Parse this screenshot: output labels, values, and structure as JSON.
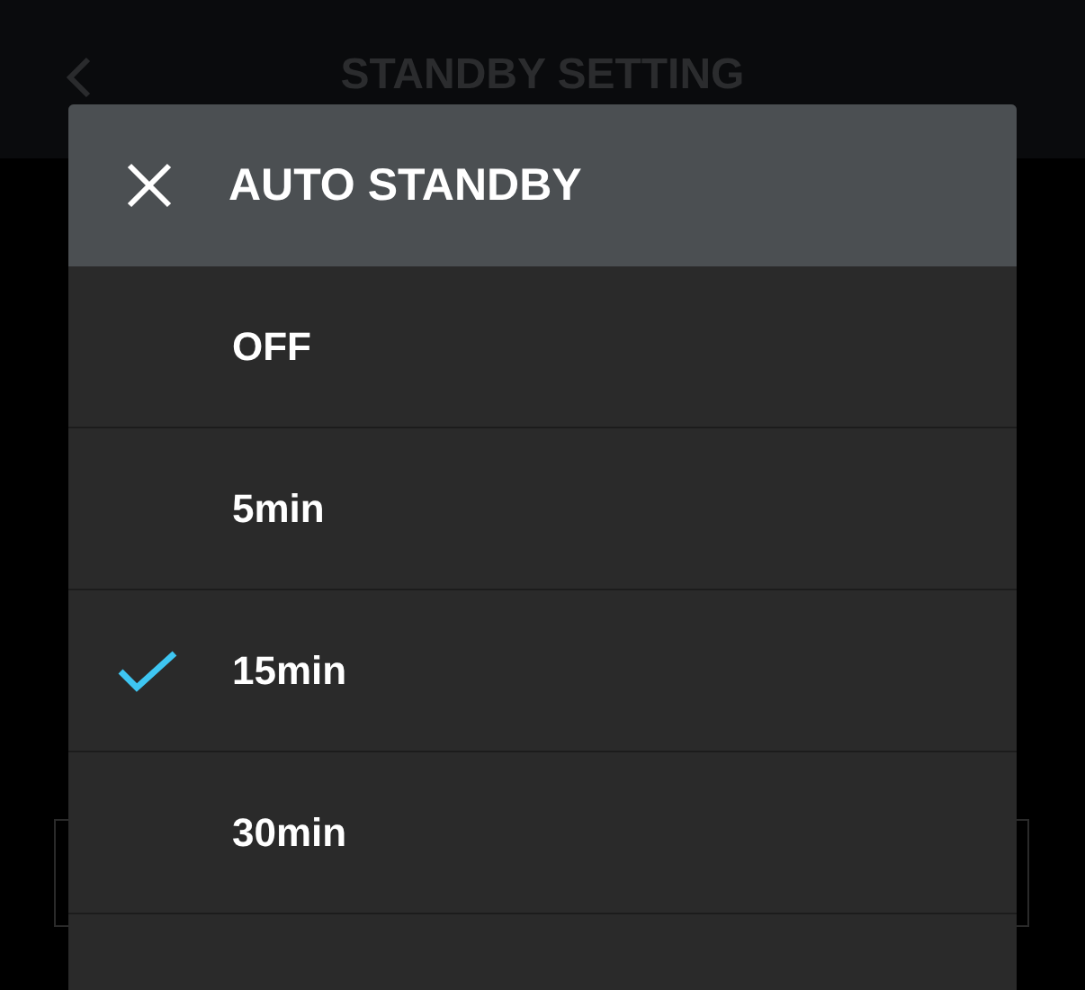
{
  "screen": {
    "title": "STANDBY SETTING"
  },
  "dialog": {
    "title": "AUTO STANDBY",
    "options": [
      {
        "label": "OFF",
        "selected": false
      },
      {
        "label": "5min",
        "selected": false
      },
      {
        "label": "15min",
        "selected": true
      },
      {
        "label": "30min",
        "selected": false
      }
    ]
  }
}
